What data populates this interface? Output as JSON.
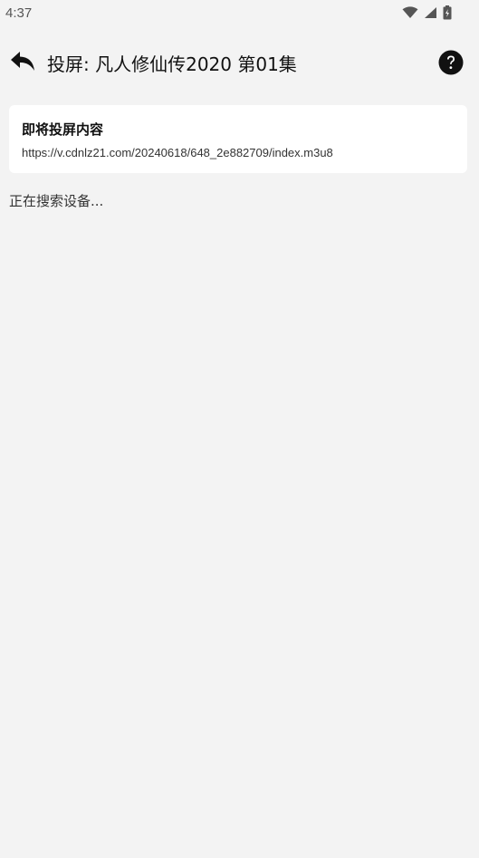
{
  "status_bar": {
    "time": "4:37",
    "icons": [
      "wifi-icon",
      "signal-icon",
      "battery-icon"
    ]
  },
  "app_bar": {
    "title": "投屏: 凡人修仙传2020 第01集",
    "back_icon": "back-icon",
    "help_icon": "help-icon"
  },
  "card": {
    "title": "即将投屏内容",
    "url": "https://v.cdnlz21.com/20240618/648_2e882709/index.m3u8"
  },
  "status_text": "正在搜索设备..."
}
